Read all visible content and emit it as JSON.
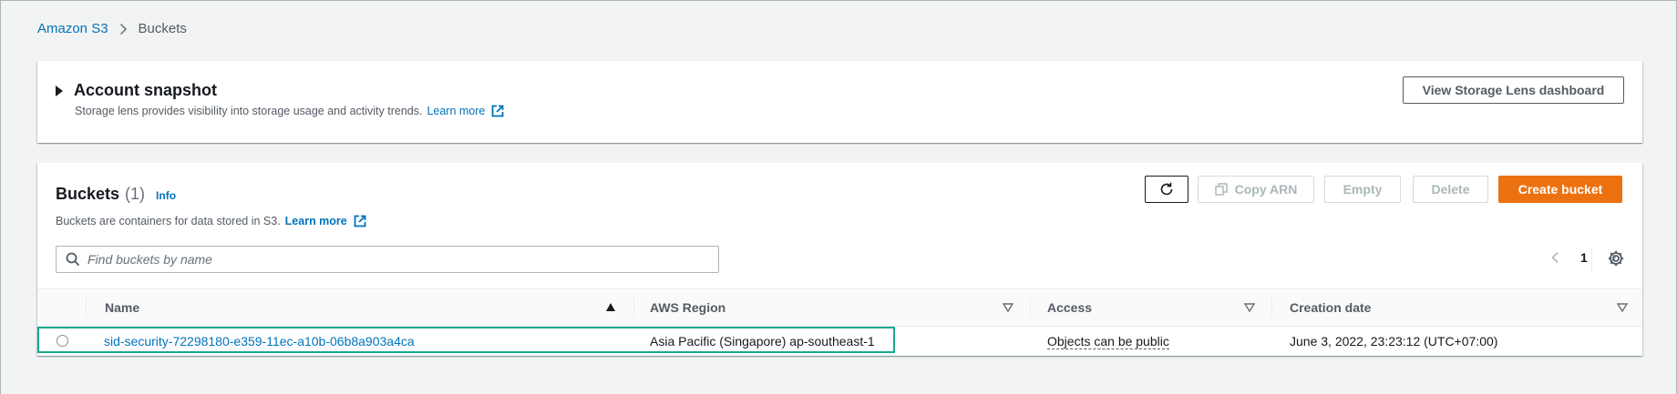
{
  "breadcrumb": {
    "root": "Amazon S3",
    "current": "Buckets"
  },
  "snapshot": {
    "title": "Account snapshot",
    "description": "Storage lens provides visibility into storage usage and activity trends.",
    "learn_more": "Learn more",
    "lens_button": "View Storage Lens dashboard"
  },
  "buckets": {
    "title": "Buckets",
    "count": "(1)",
    "info": "Info",
    "description": "Buckets are containers for data stored in S3.",
    "learn_more": "Learn more",
    "toolbar": {
      "copy_arn": "Copy ARN",
      "empty": "Empty",
      "delete": "Delete",
      "create": "Create bucket"
    },
    "search": {
      "placeholder": "Find buckets by name",
      "value": ""
    },
    "pagination": {
      "page": "1"
    },
    "columns": [
      "Name",
      "AWS Region",
      "Access",
      "Creation date"
    ],
    "rows": [
      {
        "name": "sid-security-72298180-e359-11ec-a10b-06b8a903a4ca",
        "region": "Asia Pacific (Singapore) ap-southeast-1",
        "access": "Objects can be public",
        "created": "June 3, 2022, 23:23:12 (UTC+07:00)"
      }
    ]
  },
  "colors": {
    "primary": "#ec7211",
    "link": "#0073bb",
    "highlight": "#1aa88b",
    "background": "#f2f3f3"
  },
  "icons": [
    "chevron-right-icon",
    "caret-right-icon",
    "external-link-icon",
    "refresh-icon",
    "copy-icon",
    "search-icon",
    "chevron-left-icon",
    "settings-icon",
    "sort-ascending-icon",
    "sort-icon"
  ]
}
